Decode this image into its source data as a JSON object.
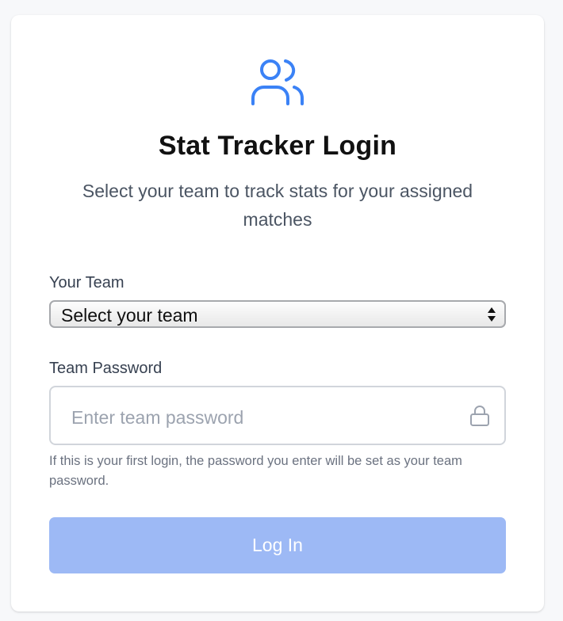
{
  "header": {
    "logo_icon": "users-icon",
    "title": "Stat Tracker Login",
    "subtitle": "Select your team to track stats for your assigned matches"
  },
  "team_field": {
    "label": "Your Team",
    "selected_value": "Select your team"
  },
  "password_field": {
    "label": "Team Password",
    "placeholder": "Enter team password",
    "value": "",
    "icon": "lock-icon",
    "help_text": "If this is your first login, the password you enter will be set as your team password."
  },
  "login_button": {
    "label": "Log In",
    "color": "#9db9f5"
  },
  "colors": {
    "accent": "#3b82f6",
    "page_background": "#f7f8fa",
    "card_background": "#ffffff"
  }
}
